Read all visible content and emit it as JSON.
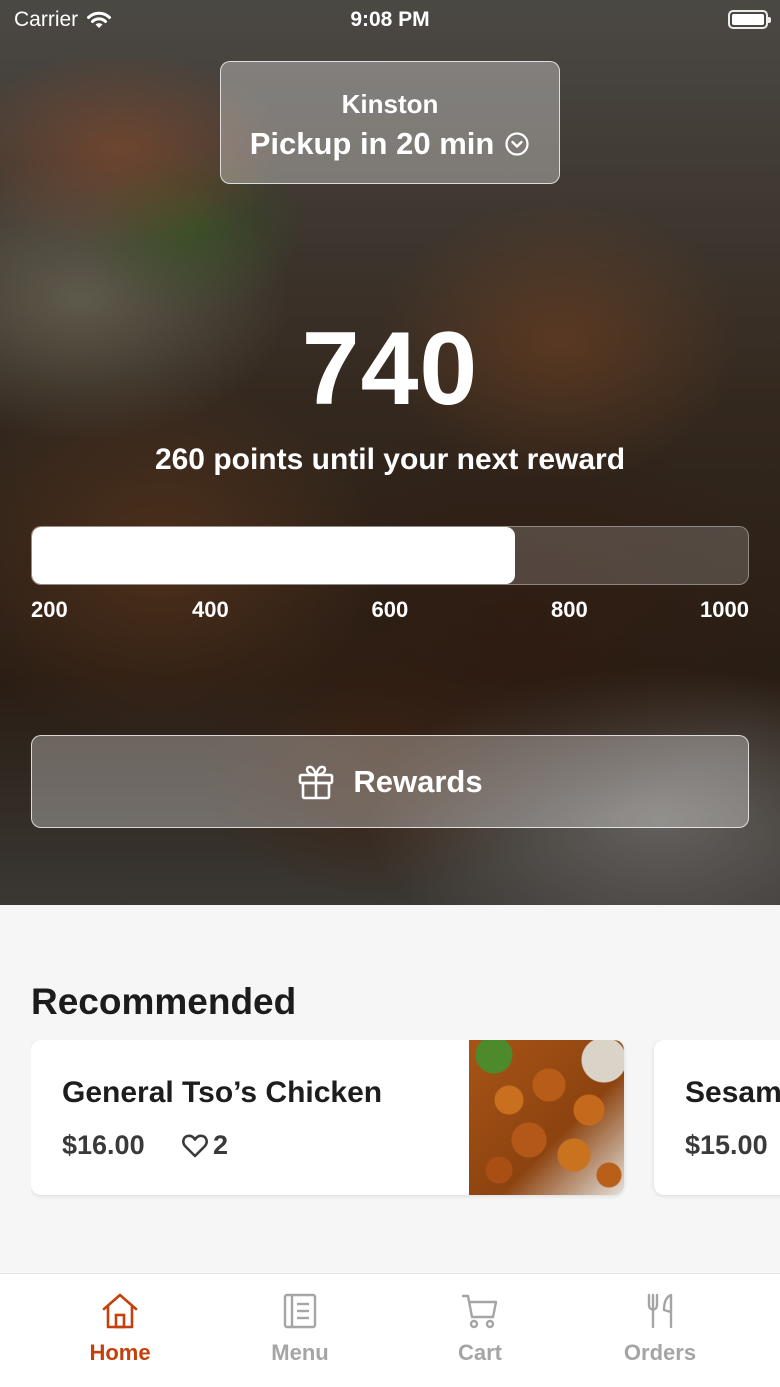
{
  "status_bar": {
    "carrier": "Carrier",
    "time": "9:08 PM"
  },
  "location": {
    "city": "Kinston",
    "pickup": "Pickup in 20 min"
  },
  "loyalty": {
    "points": "740",
    "points_value": 740,
    "message": "260 points until your next reward",
    "progress_min": 200,
    "progress_max": 1000,
    "ticks": [
      "200",
      "400",
      "600",
      "800",
      "1000"
    ]
  },
  "rewards_button": {
    "label": "Rewards"
  },
  "recommended": {
    "title": "Recommended",
    "items": [
      {
        "name": "General Tso’s Chicken",
        "price": "$16.00",
        "likes": "2"
      },
      {
        "name": "Sesam",
        "price": "$15.00"
      }
    ]
  },
  "tabs": [
    {
      "label": "Home",
      "icon": "home-icon",
      "active": true
    },
    {
      "label": "Menu",
      "icon": "menu-icon",
      "active": false
    },
    {
      "label": "Cart",
      "icon": "cart-icon",
      "active": false
    },
    {
      "label": "Orders",
      "icon": "orders-icon",
      "active": false
    }
  ],
  "colors": {
    "accent": "#c2410c",
    "inactive": "#a5a5a5"
  }
}
